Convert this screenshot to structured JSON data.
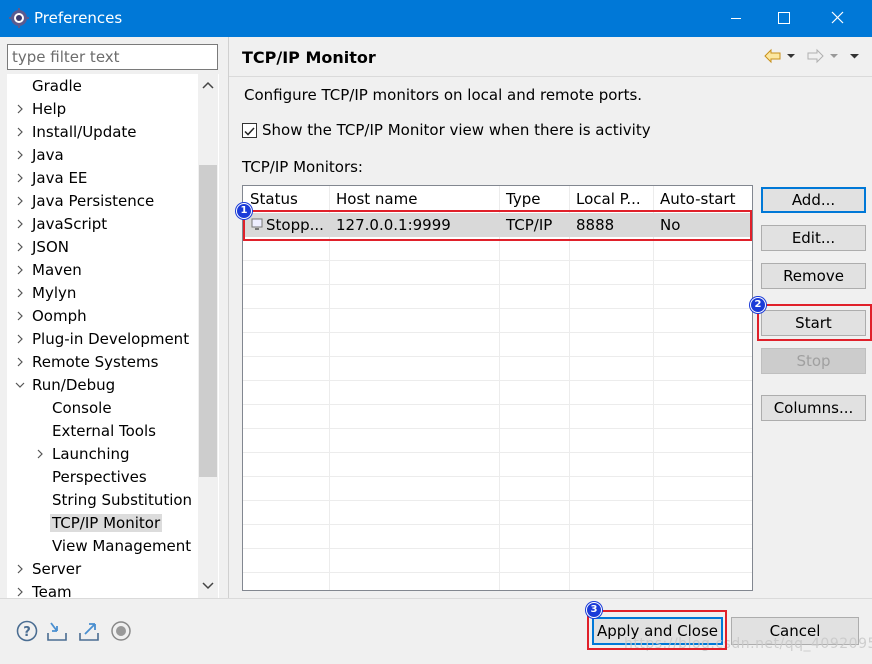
{
  "window": {
    "title": "Preferences"
  },
  "filter": {
    "placeholder": "type filter text"
  },
  "tree": {
    "items": [
      {
        "label": "Gradle"
      },
      {
        "label": "Help"
      },
      {
        "label": "Install/Update"
      },
      {
        "label": "Java"
      },
      {
        "label": "Java EE"
      },
      {
        "label": "Java Persistence"
      },
      {
        "label": "JavaScript"
      },
      {
        "label": "JSON"
      },
      {
        "label": "Maven"
      },
      {
        "label": "Mylyn"
      },
      {
        "label": "Oomph"
      },
      {
        "label": "Plug-in Development"
      },
      {
        "label": "Remote Systems"
      },
      {
        "label": "Run/Debug"
      },
      {
        "label": "Console"
      },
      {
        "label": "External Tools"
      },
      {
        "label": "Launching"
      },
      {
        "label": "Perspectives"
      },
      {
        "label": "String Substitution"
      },
      {
        "label": "TCP/IP Monitor"
      },
      {
        "label": "View Management"
      },
      {
        "label": "Server"
      },
      {
        "label": "Team"
      }
    ]
  },
  "page": {
    "title": "TCP/IP Monitor",
    "description": "Configure TCP/IP monitors on local and remote ports.",
    "show_view_label": "Show the TCP/IP Monitor view when there is activity",
    "show_view_checked": true,
    "monitors_label": "TCP/IP Monitors:"
  },
  "table": {
    "columns": [
      "Status",
      "Host name",
      "Type",
      "Local P...",
      "Auto-start"
    ],
    "rows": [
      {
        "status": "Stopp...",
        "host": "127.0.0.1:9999",
        "type": "TCP/IP",
        "local_port": "8888",
        "auto_start": "No"
      }
    ]
  },
  "buttons": {
    "add": "Add...",
    "edit": "Edit...",
    "remove": "Remove",
    "start": "Start",
    "stop": "Stop",
    "columns": "Columns...",
    "apply_close": "Apply and Close",
    "cancel": "Cancel"
  },
  "annotations": {
    "badge1": "1",
    "badge2": "2",
    "badge3": "3",
    "color": "#e0202a"
  },
  "bottom_icons": [
    "help-icon",
    "import-icon",
    "export-icon",
    "record-icon"
  ],
  "watermark": "https://blog.csdn.net/qq_40920955",
  "colors": {
    "title_bar": "#0078d7",
    "selection": "#d9d9d9",
    "badge": "#1b3bd8"
  }
}
